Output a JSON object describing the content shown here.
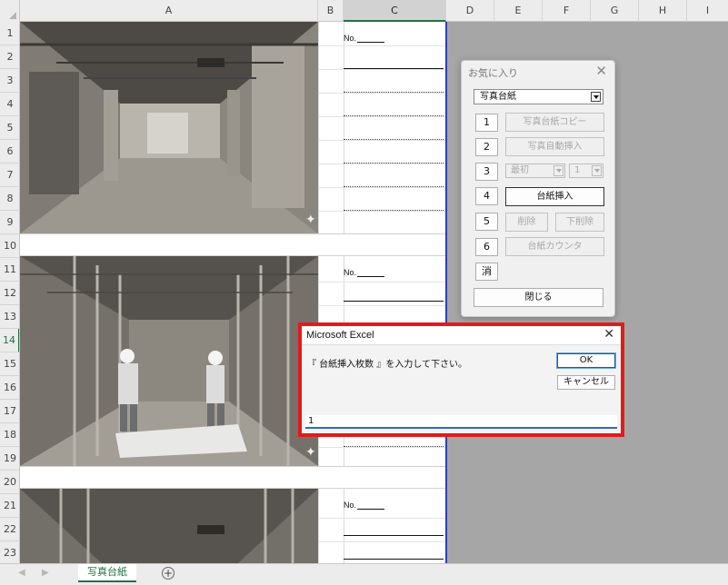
{
  "columns": [
    "A",
    "B",
    "C",
    "D",
    "E",
    "F",
    "G",
    "H",
    "I"
  ],
  "rows": [
    "1",
    "2",
    "3",
    "4",
    "5",
    "6",
    "7",
    "8",
    "9",
    "10",
    "11",
    "12",
    "13",
    "14",
    "15",
    "16",
    "17",
    "18",
    "19",
    "20",
    "21",
    "22",
    "23"
  ],
  "active_row": "14",
  "sheet_cells": {
    "no_label_1": "No.",
    "no_label_2": "No.",
    "no_label_3": "No."
  },
  "favorites_panel": {
    "title": "お気に入り",
    "close_glyph": "✕",
    "selected_template": "写真台紙",
    "buttons": [
      {
        "num": "1",
        "label": "写真台紙コピー",
        "enabled": false
      },
      {
        "num": "2",
        "label": "写真自動挿入",
        "enabled": false
      },
      {
        "num": "3",
        "select_a": "最初",
        "select_b": "1",
        "enabled": false
      },
      {
        "num": "4",
        "label": "台紙挿入",
        "enabled": true
      },
      {
        "num": "5",
        "label_a": "削除",
        "label_b": "下削除",
        "enabled": false
      },
      {
        "num": "6",
        "label": "台紙カウンタ",
        "enabled": false
      }
    ],
    "erase_label": "消",
    "close_label": "閉じる"
  },
  "dialog": {
    "title": "Microsoft Excel",
    "close_glyph": "✕",
    "prompt": "『 台紙挿入枚数 』を入力して下さい。",
    "ok_label": "OK",
    "cancel_label": "キャンセル",
    "input_value": "1"
  },
  "tabbar": {
    "prev_glyph": "◀",
    "next_glyph": "▶",
    "sheet_tab": "写真台紙",
    "add_glyph": "+"
  },
  "colors": {
    "excel_green": "#217346",
    "highlight_red": "#e31a1a",
    "print_border_blue": "#2b3fb5"
  }
}
